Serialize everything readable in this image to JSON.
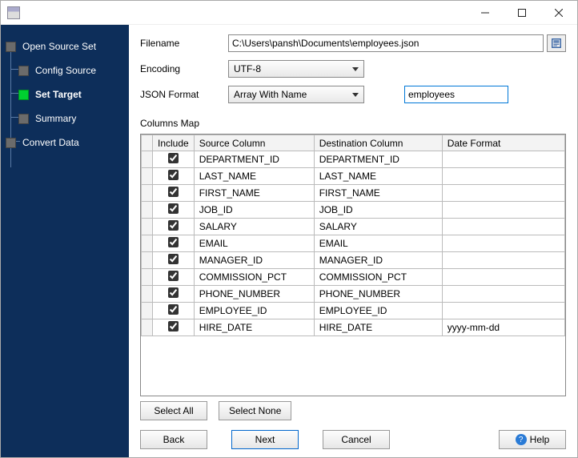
{
  "titlebar": {
    "title": ""
  },
  "sidebar": {
    "items": [
      {
        "label": "Open Source Set"
      },
      {
        "label": "Config Source"
      },
      {
        "label": "Set Target"
      },
      {
        "label": "Summary"
      },
      {
        "label": "Convert Data"
      }
    ]
  },
  "form": {
    "filename_label": "Filename",
    "filename_value": "C:\\Users\\pansh\\Documents\\employees.json",
    "encoding_label": "Encoding",
    "encoding_value": "UTF-8",
    "format_label": "JSON Format",
    "format_value": "Array With Name",
    "name_value": "employees"
  },
  "columns": {
    "section_label": "Columns Map",
    "headers": {
      "include": "Include",
      "source": "Source Column",
      "dest": "Destination Column",
      "datefmt": "Date Format"
    },
    "rows": [
      {
        "include": true,
        "source": "DEPARTMENT_ID",
        "dest": "DEPARTMENT_ID",
        "datefmt": ""
      },
      {
        "include": true,
        "source": "LAST_NAME",
        "dest": "LAST_NAME",
        "datefmt": ""
      },
      {
        "include": true,
        "source": "FIRST_NAME",
        "dest": "FIRST_NAME",
        "datefmt": ""
      },
      {
        "include": true,
        "source": "JOB_ID",
        "dest": "JOB_ID",
        "datefmt": ""
      },
      {
        "include": true,
        "source": "SALARY",
        "dest": "SALARY",
        "datefmt": ""
      },
      {
        "include": true,
        "source": "EMAIL",
        "dest": "EMAIL",
        "datefmt": ""
      },
      {
        "include": true,
        "source": "MANAGER_ID",
        "dest": "MANAGER_ID",
        "datefmt": ""
      },
      {
        "include": true,
        "source": "COMMISSION_PCT",
        "dest": "COMMISSION_PCT",
        "datefmt": ""
      },
      {
        "include": true,
        "source": "PHONE_NUMBER",
        "dest": "PHONE_NUMBER",
        "datefmt": ""
      },
      {
        "include": true,
        "source": "EMPLOYEE_ID",
        "dest": "EMPLOYEE_ID",
        "datefmt": ""
      },
      {
        "include": true,
        "source": "HIRE_DATE",
        "dest": "HIRE_DATE",
        "datefmt": "yyyy-mm-dd"
      }
    ]
  },
  "buttons": {
    "select_all": "Select All",
    "select_none": "Select None",
    "back": "Back",
    "next": "Next",
    "cancel": "Cancel",
    "help": "Help"
  }
}
